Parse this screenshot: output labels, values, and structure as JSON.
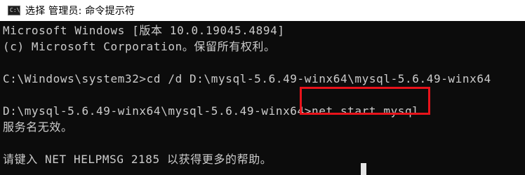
{
  "window": {
    "icon_text": "C:\\",
    "title": "选择 管理员: 命令提示符"
  },
  "console": {
    "lines": [
      "Microsoft Windows [版本 10.0.19045.4894]",
      "(c) Microsoft Corporation。保留所有权利。",
      "",
      "C:\\Windows\\system32>cd /d D:\\mysql-5.6.49-winx64\\mysql-5.6.49-winx64",
      "",
      "D:\\mysql-5.6.49-winx64\\mysql-5.6.49-winx64>net start mysql",
      "服务名无效。",
      "",
      "请键入 NET HELPMSG 2185 以获得更多的帮助。"
    ]
  },
  "colors": {
    "background": "#0c0c0c",
    "text": "#cccccc",
    "highlight_border": "#e8131b"
  }
}
